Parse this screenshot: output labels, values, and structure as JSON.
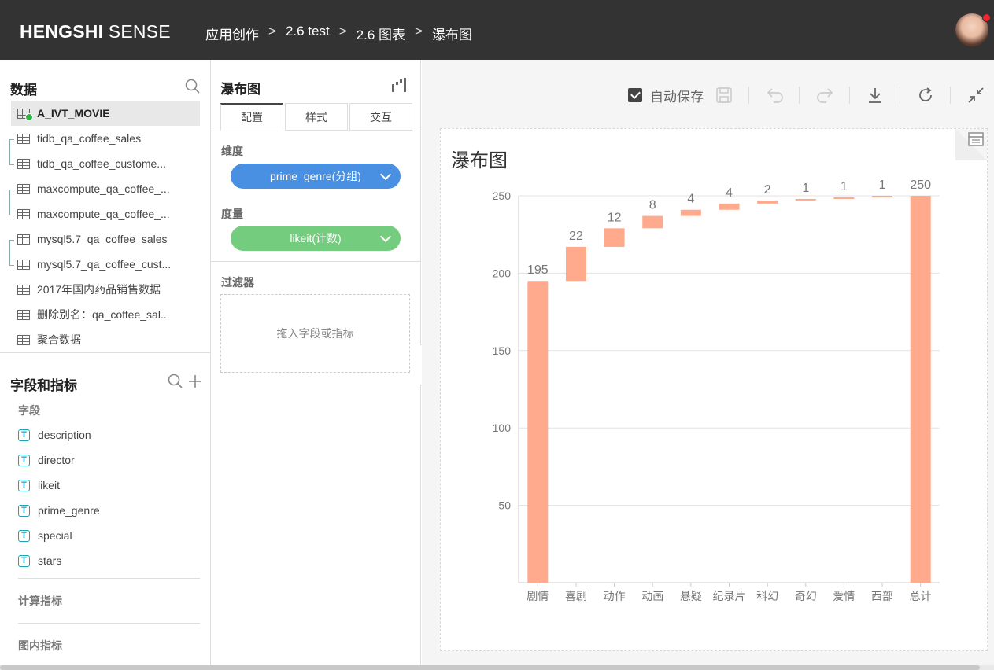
{
  "topbar": {
    "logo_bold": "HENGSHI",
    "logo_light": " SENSE",
    "breadcrumb": [
      "应用创作",
      "2.6 test",
      "2.6 图表",
      "瀑布图"
    ],
    "breadcrumb_sep": ">"
  },
  "data_panel": {
    "title": "数据",
    "datasets": [
      "A_IVT_MOVIE",
      "tidb_qa_coffee_sales",
      "tidb_qa_coffee_custome...",
      "maxcompute_qa_coffee_...",
      "maxcompute_qa_coffee_...",
      "mysql5.7_qa_coffee_sales",
      "mysql5.7_qa_coffee_cust...",
      "2017年国内药品销售数据",
      "删除别名：qa_coffee_sal...",
      "聚合数据"
    ]
  },
  "fields_panel": {
    "title": "字段和指标",
    "fields_label": "字段",
    "fields": [
      "description",
      "director",
      "likeit",
      "prime_genre",
      "special",
      "stars"
    ],
    "calc_label": "计算指标",
    "chart_metric_label": "图内指标"
  },
  "config_panel": {
    "title": "瀑布图",
    "tabs": [
      "配置",
      "样式",
      "交互"
    ],
    "dimension_label": "维度",
    "dimension_value": "prime_genre(分组)",
    "measure_label": "度量",
    "measure_value": "likeit(计数)",
    "filter_label": "过滤器",
    "filter_placeholder": "拖入字段或指标",
    "dimension_color": "#4a90e2",
    "measure_color": "#74cc7e"
  },
  "toolbar": {
    "autosave_label": "自动保存",
    "autosave_checked": true
  },
  "chart_card": {
    "title": "瀑布图"
  },
  "chart_data": {
    "type": "bar",
    "subtype": "waterfall",
    "categories": [
      "剧情",
      "喜剧",
      "动作",
      "动画",
      "悬疑",
      "纪录片",
      "科幻",
      "奇幻",
      "爱情",
      "西部",
      "总计"
    ],
    "values": [
      195,
      22,
      12,
      8,
      4,
      4,
      2,
      1,
      1,
      1,
      250
    ],
    "is_total": [
      false,
      false,
      false,
      false,
      false,
      false,
      false,
      false,
      false,
      false,
      true
    ],
    "yticks": [
      50,
      100,
      150,
      200,
      250
    ],
    "ylim": [
      0,
      250
    ],
    "bar_color": "#ffaa8c",
    "grid": true,
    "legend": "none"
  }
}
